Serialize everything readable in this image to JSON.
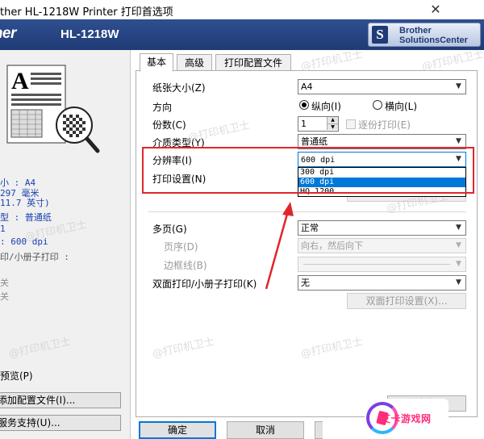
{
  "window": {
    "title": "ther HL-1218W Printer 打印首选项",
    "close_glyph": "✕"
  },
  "banner": {
    "brand": "ther",
    "model": "HL-1218W",
    "solutions_center": [
      "Brother",
      "SolutionsCenter"
    ],
    "solutions_icon": "S"
  },
  "summary": {
    "lines": [
      {
        "text": "小 : A4",
        "style": "blue"
      },
      {
        "text": "297 毫米",
        "style": "blue"
      },
      {
        "text": "11.7 英寸)",
        "style": "blue"
      },
      {
        "text": "型 : 普通纸",
        "style": "blue"
      },
      {
        "text": "1",
        "style": "blue"
      },
      {
        "text": ": 600 dpi",
        "style": "blue"
      },
      {
        "text": "印/小册子打印 :",
        "style": "gray"
      },
      {
        "text": "关",
        "style": "dim"
      },
      {
        "text": "关",
        "style": "dim"
      }
    ],
    "preview_link": "预览(P)",
    "add_profile_button": "添加配置文件(I)...",
    "support_button": "服务支持(U)..."
  },
  "tabs": [
    {
      "label": "基本",
      "active": true
    },
    {
      "label": "高级",
      "active": false
    },
    {
      "label": "打印配置文件",
      "active": false
    }
  ],
  "basic": {
    "paper_size": {
      "label": "纸张大小(Z)",
      "value": "A4"
    },
    "orientation": {
      "label": "方向",
      "options": [
        {
          "label": "纵向(I)",
          "checked": true
        },
        {
          "label": "横向(L)",
          "checked": false
        }
      ]
    },
    "copies": {
      "label": "份数(C)",
      "value": "1",
      "collate_label": "逐份打印(E)",
      "collate_checked": false
    },
    "media_type": {
      "label": "介质类型(Y)",
      "value": "普通纸"
    },
    "resolution": {
      "label": "分辨率(I)",
      "value": "600 dpi",
      "options": [
        "300 dpi",
        "600 dpi",
        "HQ 1200"
      ],
      "selected_index": 1
    },
    "print_settings": {
      "label": "打印设置(N)"
    },
    "multipage": {
      "label": "多页(G)",
      "value": "正常"
    },
    "page_order": {
      "label": "页序(D)",
      "value": "向右，然后向下"
    },
    "border_line": {
      "label": "边框线(B)",
      "value": ""
    },
    "duplex": {
      "label": "双面打印/小册子打印(K)",
      "value": "无",
      "settings_button": "双面打印设置(X)..."
    },
    "default_button": "默认值(T)"
  },
  "footer": {
    "ok": "确定",
    "cancel": "取消"
  },
  "watermarks": [
    "@打印机卫士",
    "@打印机卫士",
    "@打印机卫士",
    "@打印机卫士",
    "@打印机卫士",
    "@打印机卫士",
    "@打印机卫士",
    "@打印机卫士"
  ],
  "site_badge": {
    "text": "艾卡游戏网"
  },
  "colors": {
    "banner": "#1f3b75",
    "highlight": "#0078d7",
    "annotation_red": "#e0262b",
    "summary_blue": "#1a3fb0"
  },
  "icons": {
    "close": "close-icon",
    "dropdown": "chevron-down-icon",
    "document_preview": "document-preview-icon",
    "magnifier": "magnifier-icon"
  }
}
